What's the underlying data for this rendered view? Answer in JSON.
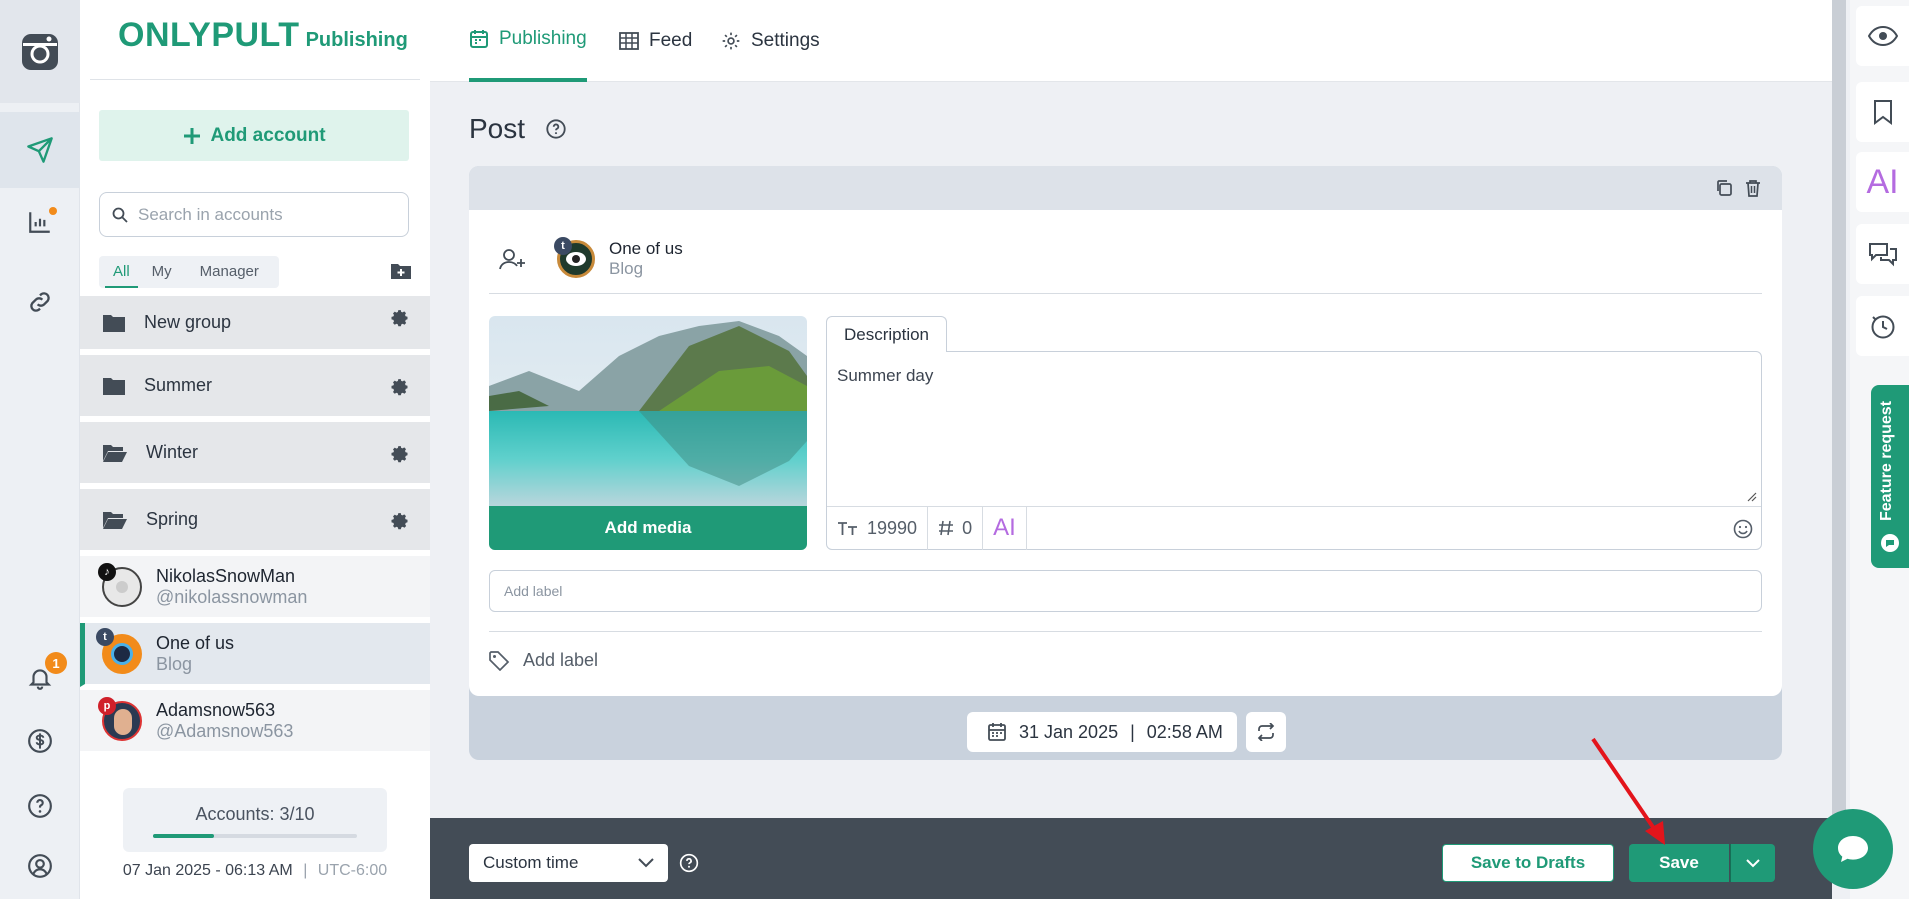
{
  "sidebar": {
    "brand_main": "ONLYPULT",
    "brand_sub": "Publishing",
    "add_account": "Add account",
    "search_placeholder": "Search in accounts",
    "filters": [
      "All",
      "My",
      "Manager"
    ],
    "groups": [
      "New group",
      "Summer",
      "Winter",
      "Spring"
    ],
    "accounts": [
      {
        "name": "NikolasSnowMan",
        "handle": "@nikolassnowman",
        "network": "tiktok"
      },
      {
        "name": "One of us",
        "handle": "Blog",
        "network": "tumblr"
      },
      {
        "name": "Adamsnow563",
        "handle": "@Adamsnow563",
        "network": "pinterest"
      }
    ],
    "accounts_count": "Accounts: 3/10",
    "accounts_fill": 0.3,
    "date": "07 Jan 2025 - 06:13 AM",
    "tz_sep": "|",
    "timezone": "UTC-6:00"
  },
  "rail": {
    "notifications_badge": "1"
  },
  "nav": {
    "tabs": [
      "Publishing",
      "Feed",
      "Settings"
    ]
  },
  "post": {
    "title": "Post",
    "account_name": "One of us",
    "account_type": "Blog",
    "add_media": "Add media",
    "description_tab": "Description",
    "description_text": "Summer day",
    "char_count": "19990",
    "hashtag_count": "0",
    "ai_label": "AI",
    "label_placeholder": "Add label",
    "add_label": "Add label",
    "date": "31 Jan 2025",
    "date_sep": "|",
    "time": "02:58 AM"
  },
  "bottom": {
    "schedule_mode": "Custom time",
    "save_drafts": "Save to Drafts",
    "save": "Save"
  },
  "right": {
    "ai_label": "AI",
    "feature_request": "Feature request"
  },
  "colors": {
    "accent": "#1f9a77",
    "badge": "#f28b1a",
    "ai": "#b46be0"
  }
}
